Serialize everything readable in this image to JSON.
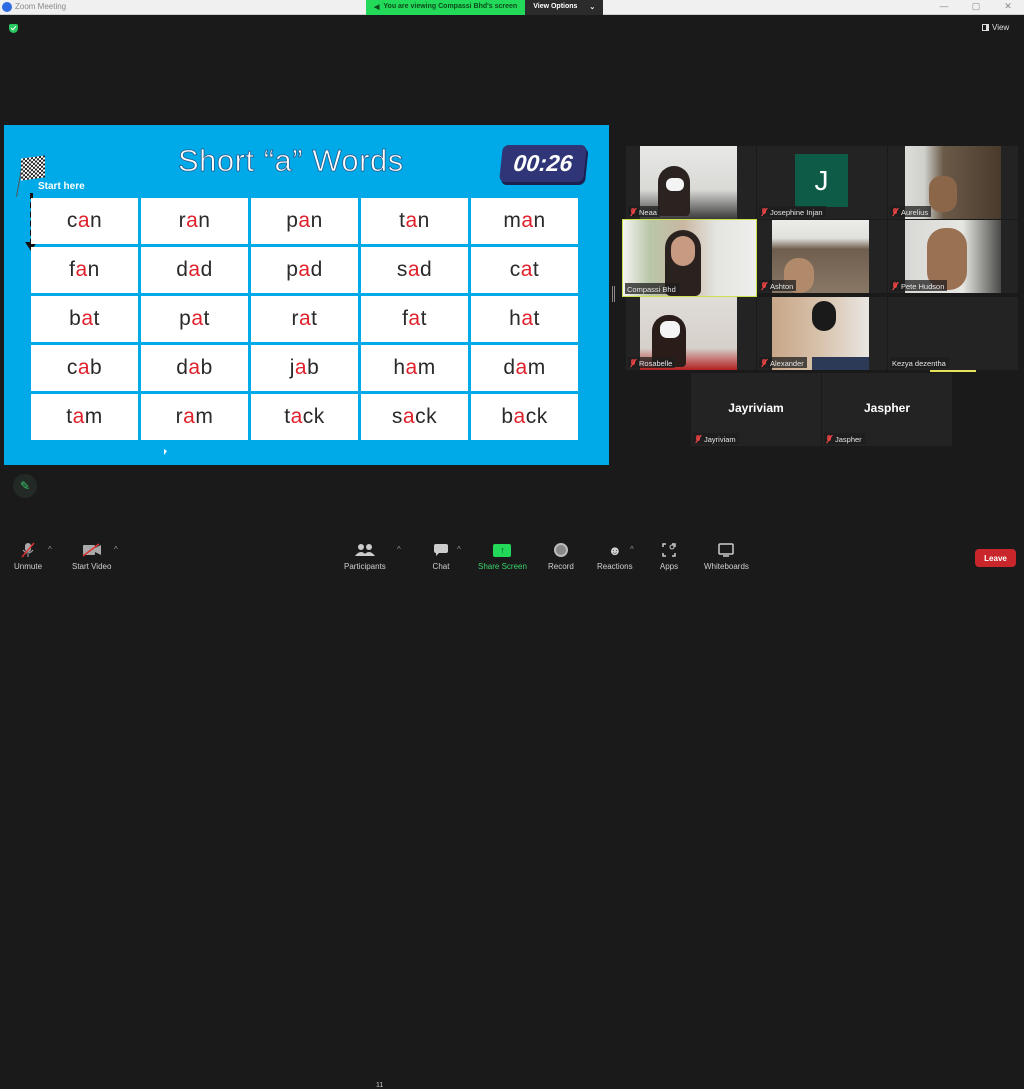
{
  "window": {
    "title": "Zoom Meeting",
    "controls": [
      "—",
      "▢",
      "✕"
    ]
  },
  "banner": {
    "viewing_text": "You are viewing Compassi Bhd's screen",
    "view_options_label": "View Options",
    "chevron": "⌄"
  },
  "top_right": {
    "view_label": "View"
  },
  "slide": {
    "title": "Short “a” Words",
    "timer": "00:26",
    "start_label": "Start here",
    "colors": {
      "background": "#00a9e8",
      "vowel": "#e0202a"
    },
    "words": [
      [
        {
          "pre": "c",
          "v": "a",
          "post": "n"
        },
        {
          "pre": "r",
          "v": "a",
          "post": "n"
        },
        {
          "pre": "p",
          "v": "a",
          "post": "n"
        },
        {
          "pre": "t",
          "v": "a",
          "post": "n"
        },
        {
          "pre": "m",
          "v": "a",
          "post": "n"
        }
      ],
      [
        {
          "pre": "f",
          "v": "a",
          "post": "n"
        },
        {
          "pre": "d",
          "v": "a",
          "post": "d"
        },
        {
          "pre": "p",
          "v": "a",
          "post": "d"
        },
        {
          "pre": "s",
          "v": "a",
          "post": "d"
        },
        {
          "pre": "c",
          "v": "a",
          "post": "t"
        }
      ],
      [
        {
          "pre": "b",
          "v": "a",
          "post": "t"
        },
        {
          "pre": "p",
          "v": "a",
          "post": "t"
        },
        {
          "pre": "r",
          "v": "a",
          "post": "t"
        },
        {
          "pre": "f",
          "v": "a",
          "post": "t"
        },
        {
          "pre": "h",
          "v": "a",
          "post": "t"
        }
      ],
      [
        {
          "pre": "c",
          "v": "a",
          "post": "b"
        },
        {
          "pre": "d",
          "v": "a",
          "post": "b"
        },
        {
          "pre": "j",
          "v": "a",
          "post": "b"
        },
        {
          "pre": "h",
          "v": "a",
          "post": "m"
        },
        {
          "pre": "d",
          "v": "a",
          "post": "m"
        }
      ],
      [
        {
          "pre": "t",
          "v": "a",
          "post": "m"
        },
        {
          "pre": "r",
          "v": "a",
          "post": "m"
        },
        {
          "pre": "t",
          "v": "a",
          "post": "ck"
        },
        {
          "pre": "s",
          "v": "a",
          "post": "ck"
        },
        {
          "pre": "b",
          "v": "a",
          "post": "ck"
        }
      ]
    ]
  },
  "participants": [
    {
      "name": "Neaa",
      "video": true,
      "muted": true
    },
    {
      "name": "Josephine Injan",
      "video": false,
      "avatar_letter": "J",
      "muted": true
    },
    {
      "name": "Aurelius",
      "video": true,
      "muted": true
    },
    {
      "name": "Compassi Bhd",
      "video": true,
      "muted": false,
      "active_speaker": true
    },
    {
      "name": "Ashton",
      "video": true,
      "muted": true
    },
    {
      "name": "Pete Hudson",
      "video": true,
      "muted": true
    },
    {
      "name": "Rosabelle",
      "video": true,
      "muted": true
    },
    {
      "name": "Alexander",
      "video": true,
      "muted": true
    },
    {
      "name": "Kezya dezentha",
      "video": false,
      "muted": false
    },
    {
      "name": "Jayriviam",
      "video": false,
      "big_name": "Jayriviam",
      "muted": true
    },
    {
      "name": "Jaspher",
      "video": false,
      "big_name": "Jaspher",
      "muted": true
    }
  ],
  "toolbar": {
    "unmute": "Unmute",
    "start_video": "Start Video",
    "participants": "Participants",
    "participants_count": "11",
    "chat": "Chat",
    "share_screen": "Share Screen",
    "record": "Record",
    "reactions": "Reactions",
    "apps": "Apps",
    "whiteboards": "Whiteboards",
    "leave": "Leave",
    "caret": "^"
  },
  "colors": {
    "accent_green": "#23d959",
    "leave_red": "#c8262b",
    "active_speaker": "#c9e04c"
  }
}
